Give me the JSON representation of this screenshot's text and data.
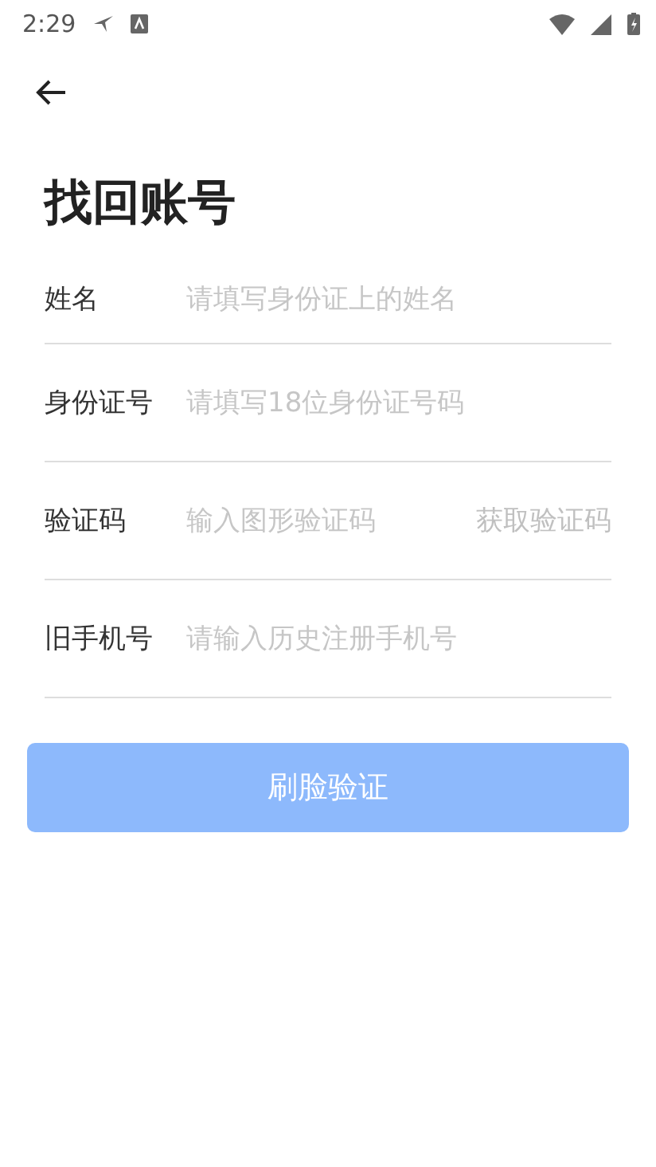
{
  "status_bar": {
    "time": "2:29"
  },
  "title": "找回账号",
  "fields": [
    {
      "label": "姓名",
      "placeholder": "请填写身份证上的姓名"
    },
    {
      "label": "身份证号",
      "placeholder": "请填写18位身份证号码"
    },
    {
      "label": "验证码",
      "placeholder": "输入图形验证码",
      "action": "获取验证码"
    },
    {
      "label": "旧手机号",
      "placeholder": "请输入历史注册手机号"
    }
  ],
  "submit": {
    "label": "刷脸验证",
    "disabled": true
  }
}
